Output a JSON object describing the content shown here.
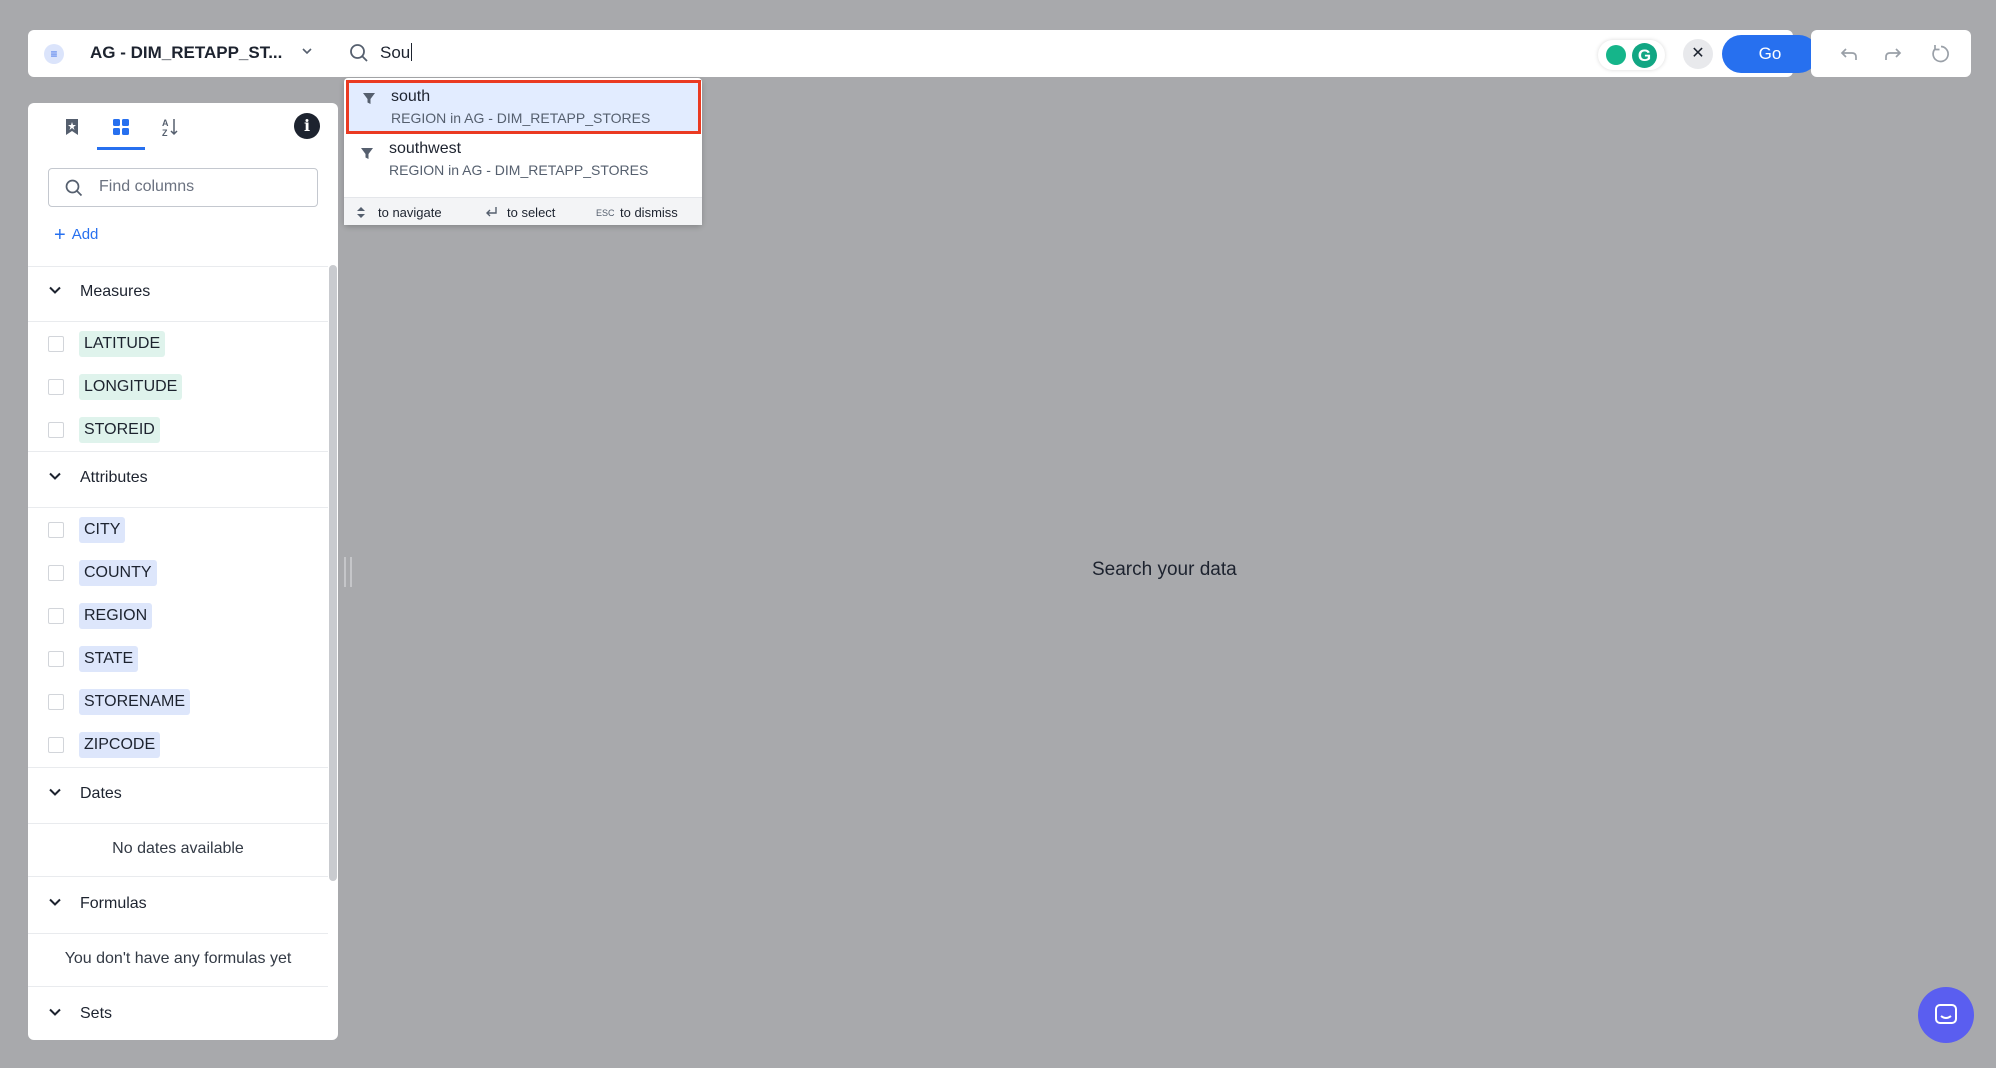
{
  "topbar": {
    "source_name": "AG - DIM_RETAPP_ST...",
    "search_query": "Sou",
    "go_label": "Go",
    "clear_label": "✕"
  },
  "suggestions": [
    {
      "title": "south",
      "subtitle": "REGION in AG - DIM_RETAPP_STORES",
      "selected": true
    },
    {
      "title": "southwest",
      "subtitle": "REGION in AG - DIM_RETAPP_STORES",
      "selected": false
    }
  ],
  "dropdown_footer": {
    "navigate": "to navigate",
    "select": "to select",
    "esc_key": "ESC",
    "dismiss": "to dismiss"
  },
  "sidebar": {
    "find_placeholder": "Find columns",
    "add_label": "Add",
    "sections": {
      "measures": {
        "title": "Measures",
        "items": [
          "LATITUDE",
          "LONGITUDE",
          "STOREID"
        ]
      },
      "attributes": {
        "title": "Attributes",
        "items": [
          "CITY",
          "COUNTY",
          "REGION",
          "STATE",
          "STORENAME",
          "ZIPCODE"
        ]
      },
      "dates": {
        "title": "Dates",
        "empty": "No dates available"
      },
      "formulas": {
        "title": "Formulas",
        "empty": "You don't have any formulas yet"
      },
      "sets": {
        "title": "Sets"
      }
    }
  },
  "main": {
    "message": "Search your data"
  },
  "colors": {
    "accent": "#2770ef",
    "highlight_border": "#ea3a22",
    "measure_pill": "#dff3ec",
    "attribute_pill": "#dde6fb",
    "chat": "#5a5ef0"
  }
}
